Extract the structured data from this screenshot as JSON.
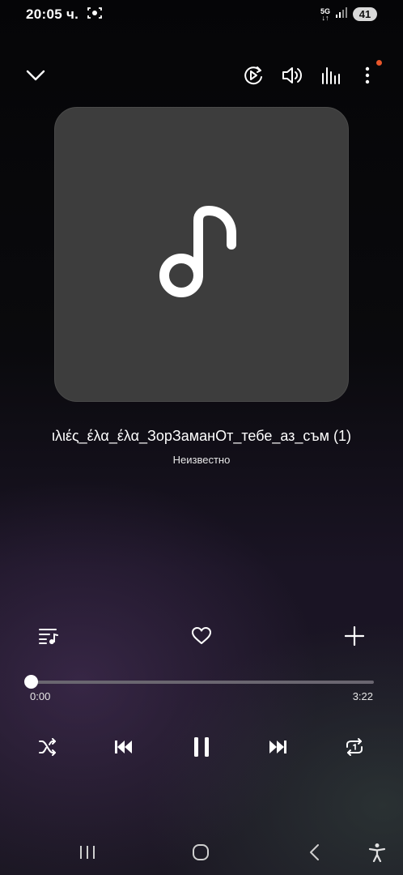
{
  "status_bar": {
    "time": "20:05 ч.",
    "network": "5G",
    "battery": "41"
  },
  "toolbar": {
    "icons": [
      "chevron-down-icon",
      "smart-view-icon",
      "volume-icon",
      "equalizer-icon",
      "more-icon"
    ],
    "notification_dot_color": "#e8562a"
  },
  "track": {
    "title": "ιλιές_έλα_έλα_ЗорЗаманОт_тебе_аз_съм (1)",
    "artist": "Неизвестно"
  },
  "progress": {
    "current": "0:00",
    "total": "3:22",
    "fraction": 0.0
  },
  "controls": [
    "shuffle-icon",
    "previous-icon",
    "pause-icon",
    "next-icon",
    "repeat-icon"
  ],
  "colors": {
    "accent": "#ffffff",
    "artwork_bg": "#3d3d3d"
  }
}
